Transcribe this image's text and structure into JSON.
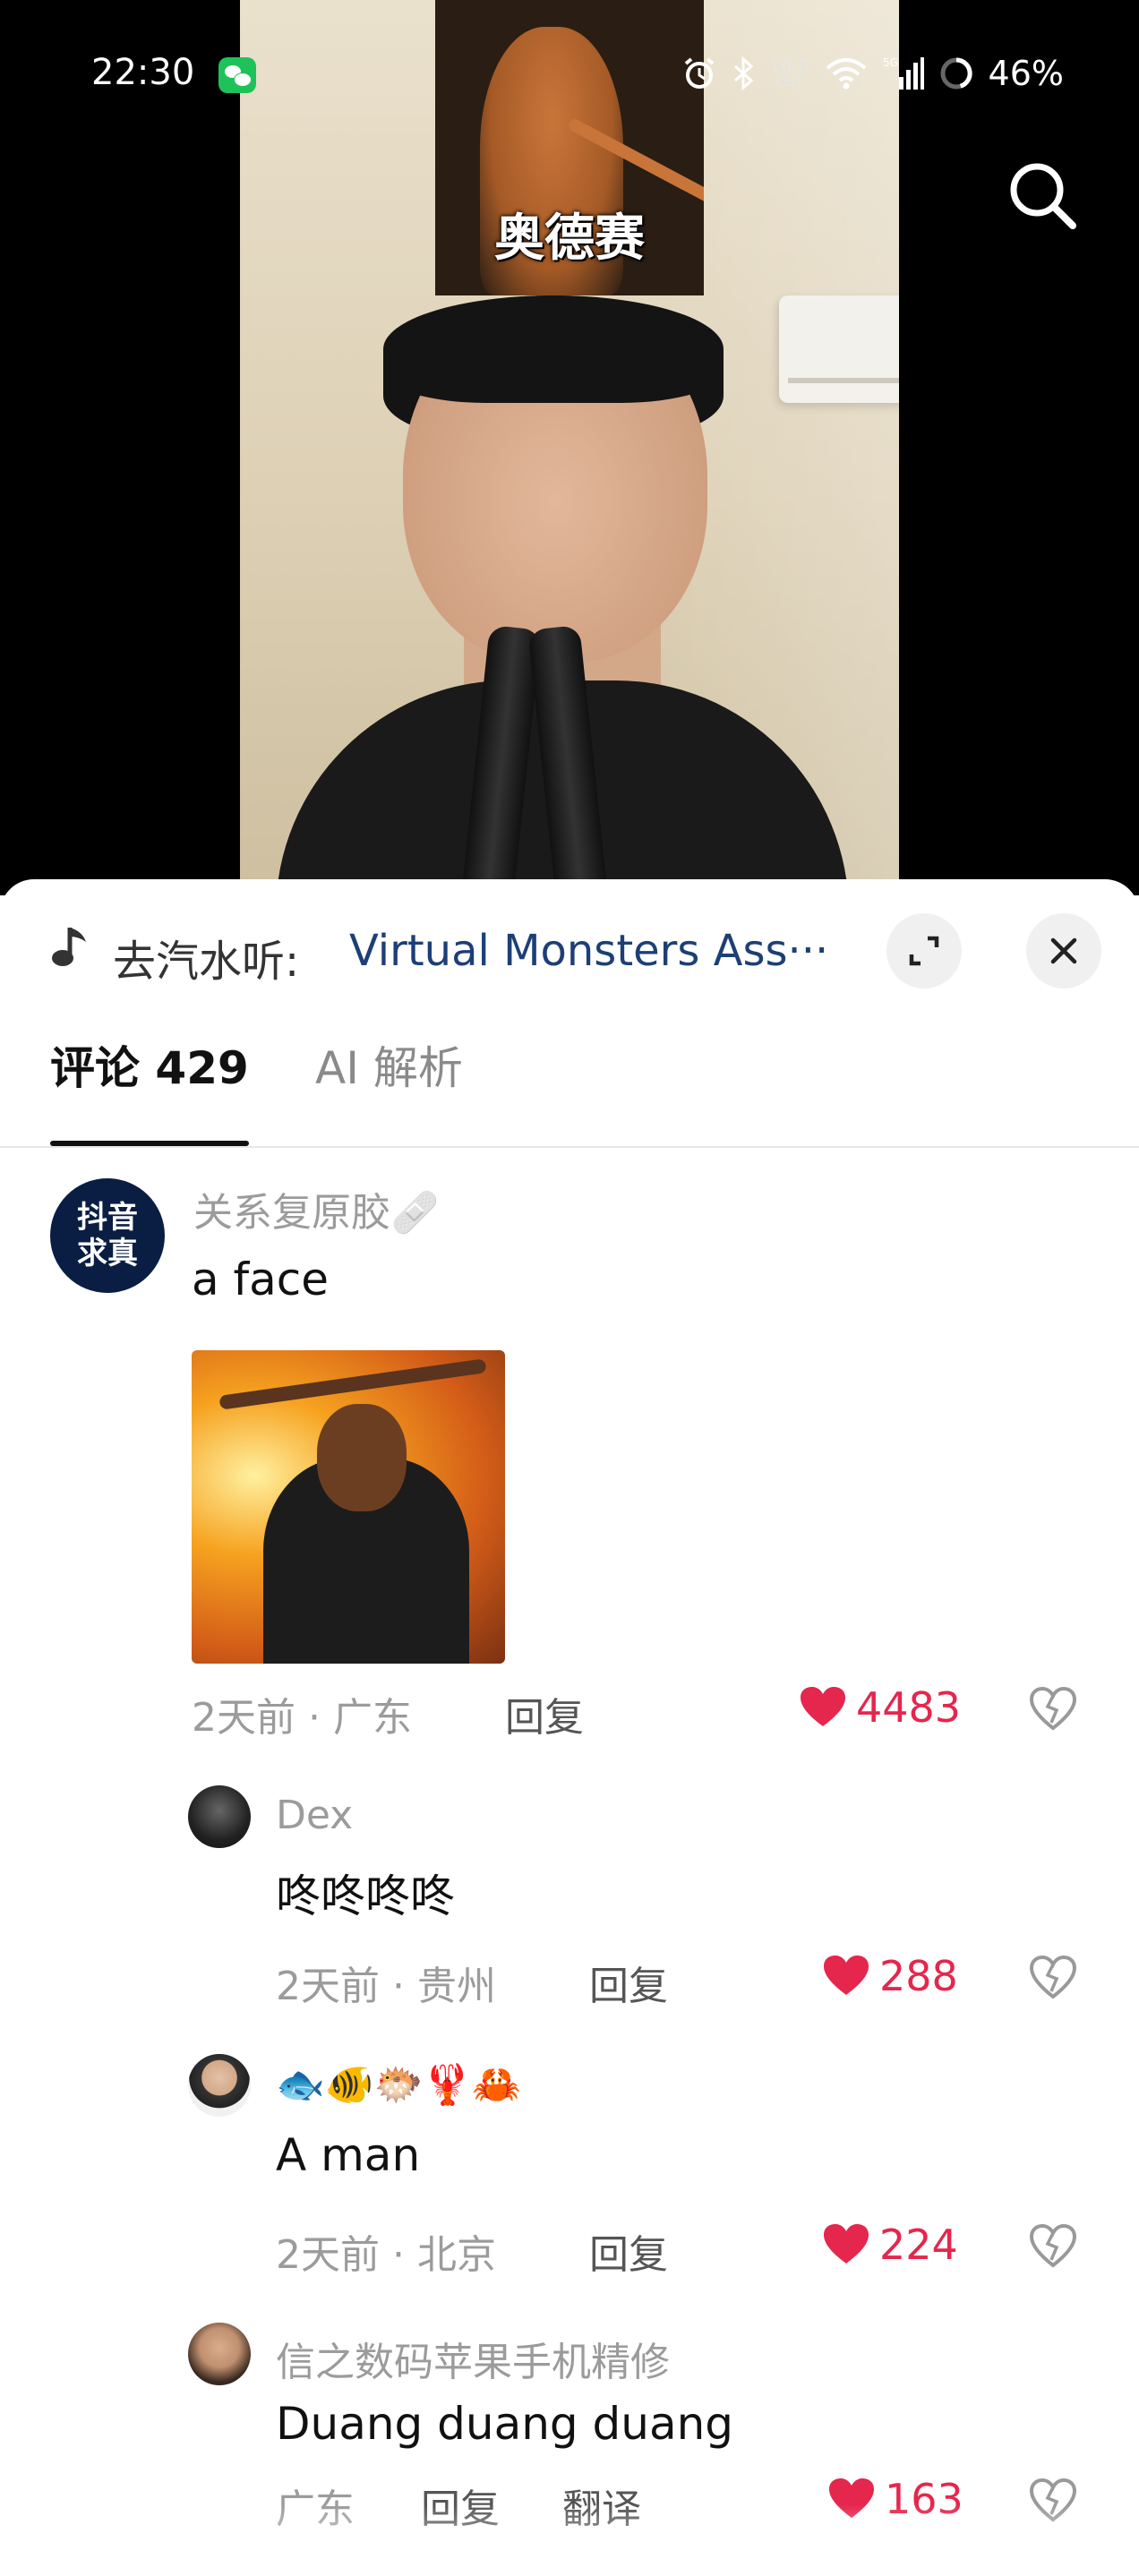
{
  "status_bar": {
    "time": "22:30",
    "net_speed": "10.0",
    "net_speed_unit": "KB/S",
    "battery": "46%",
    "icons": [
      "wechat-icon",
      "alarm-icon",
      "bluetooth-icon",
      "wifi-icon",
      "signal-icon",
      "battery-icon"
    ]
  },
  "video": {
    "caption": "奥德赛"
  },
  "music": {
    "prefix": "去汽水听:",
    "title": "Virtual Monsters Ass···"
  },
  "tabs": [
    {
      "label": "评论 429",
      "active": true
    },
    {
      "label": "AI 解析",
      "active": false
    }
  ],
  "comments": [
    {
      "avatar_text_line1": "抖音",
      "avatar_text_line2": "求真",
      "username": "关系复原胶🩹",
      "text": "a face",
      "meta": "2天前 · 广东",
      "reply": "回复",
      "likes": "4483"
    },
    {
      "username": "Dex",
      "text": "咚咚咚咚",
      "meta": "2天前 · 贵州",
      "reply": "回复",
      "likes": "288"
    },
    {
      "username": "🐟🐠🐡🦞🦀",
      "text": "A man",
      "meta": "2天前 · 北京",
      "reply": "回复",
      "likes": "224"
    },
    {
      "username": "信之数码苹果手机精修",
      "text": "Duang duang duang",
      "meta": "广东",
      "reply": "回复",
      "translate": "翻译",
      "likes": "163"
    }
  ],
  "colors": {
    "like": "#e5264d",
    "music_title": "#1d3f77",
    "muted": "#9b9b9b"
  }
}
